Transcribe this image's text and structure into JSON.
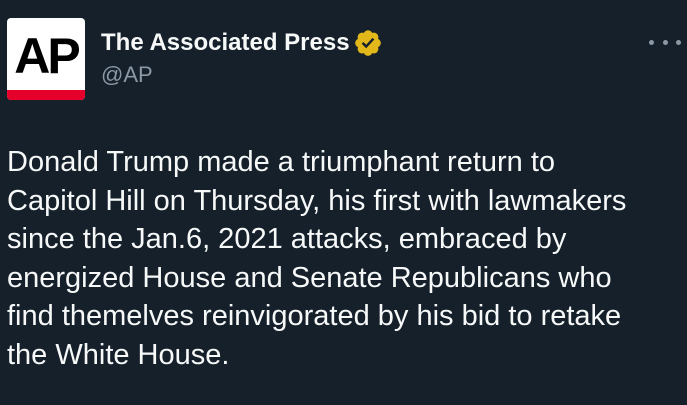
{
  "author": {
    "display_name": "The Associated Press",
    "handle": "@AP",
    "verified": true,
    "verified_badge_color": "#e2b719",
    "avatar": {
      "logo_text": "AP",
      "logo_color": "#000000",
      "background": "#ffffff",
      "accent_bar_color": "#e4002b"
    }
  },
  "menu": {
    "icon": "more-horizontal-icon"
  },
  "tweet": {
    "lines": [
      "Donald Trump made a triumphant return to",
      "Capitol Hill on Thursday, his first with lawmakers",
      "since the Jan.6, 2021 attacks, embraced by",
      "energized House and Senate Republicans who",
      "find themelves reinvigorated by his bid to retake",
      "the White House."
    ]
  },
  "theme": {
    "background": "#15202b",
    "text": "#f7f9f9",
    "secondary_text": "#8b98a5"
  }
}
